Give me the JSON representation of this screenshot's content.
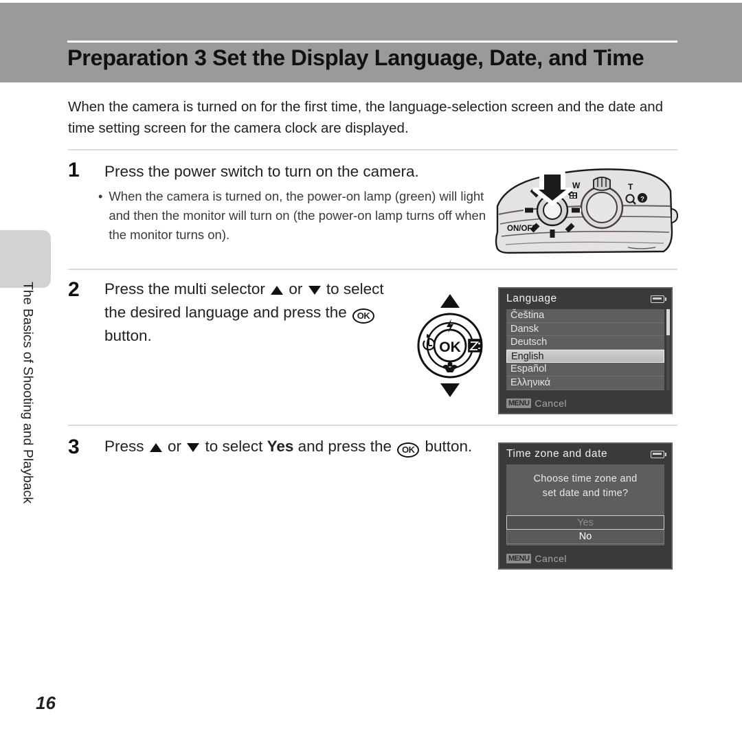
{
  "header": {
    "title": "Preparation 3 Set the Display Language, Date, and Time"
  },
  "side_tab": {
    "label": "The Basics of Shooting and Playback"
  },
  "intro": {
    "paragraph": "When the camera is turned on for the first time, the language-selection screen and the date and time setting screen for the camera clock are displayed."
  },
  "steps": [
    {
      "number": "1",
      "heading": "Press the power switch to turn on the camera.",
      "bullet_dot": "•",
      "bullet": "When the camera is turned on, the power-on lamp (green) will light and then the monitor will turn on (the power-on lamp turns off when the monitor turns on)."
    },
    {
      "number": "2",
      "text_part_1": "Press the multi selector ",
      "text_part_2": " or ",
      "text_part_3": " to select the desired language and press the ",
      "ok_label": "OK",
      "text_part_4": " button."
    },
    {
      "number": "3",
      "text_part_1": "Press ",
      "text_part_2": " or ",
      "text_part_3": " to select ",
      "emphasis": "Yes",
      "text_part_4": " and press the ",
      "ok_label": "OK",
      "text_part_5": " button."
    }
  ],
  "camera_figure": {
    "power_switch_label": "ON/OFF",
    "zoom_wide_label": "W",
    "zoom_tele_label": "T",
    "thumbnail_icon": "thumbnail-grid-icon",
    "magnify_icon": "magnify-icon",
    "help_icon": "help-question-icon",
    "arrow_icon": "down-arrow-icon"
  },
  "multi_selector_figure": {
    "center_label": "OK",
    "top_icon": "flash-icon",
    "bottom_icon": "macro-flower-icon",
    "left_icon": "self-timer-icon",
    "right_icon": "exposure-compensation-icon",
    "up_arrow_icon": "triangle-up-icon",
    "down_arrow_icon": "triangle-down-icon"
  },
  "language_screen": {
    "title": "Language",
    "battery_icon": "battery-icon",
    "items": [
      {
        "label": "Čeština",
        "selected": false
      },
      {
        "label": "Dansk",
        "selected": false
      },
      {
        "label": "Deutsch",
        "selected": false
      },
      {
        "label": "English",
        "selected": true
      },
      {
        "label": "Español",
        "selected": false
      },
      {
        "label": "Ελληνικά",
        "selected": false
      }
    ],
    "footer_badge": "MENU",
    "footer_label": "Cancel"
  },
  "timezone_screen": {
    "title": "Time zone and date",
    "battery_icon": "battery-icon",
    "question_line_1": "Choose time zone and",
    "question_line_2": "set date and time?",
    "choice_yes": "Yes",
    "choice_no": "No",
    "footer_badge": "MENU",
    "footer_label": "Cancel"
  },
  "footer": {
    "page_number": "16"
  },
  "colors": {
    "banner_gray": "#9a9a9a",
    "side_tab_gray": "#d2d2d2",
    "lcd_chrome": "#3a3a3a",
    "lcd_panel": "#5e5e5e",
    "highlight": "#cfcfcf",
    "text": "#231f20"
  }
}
